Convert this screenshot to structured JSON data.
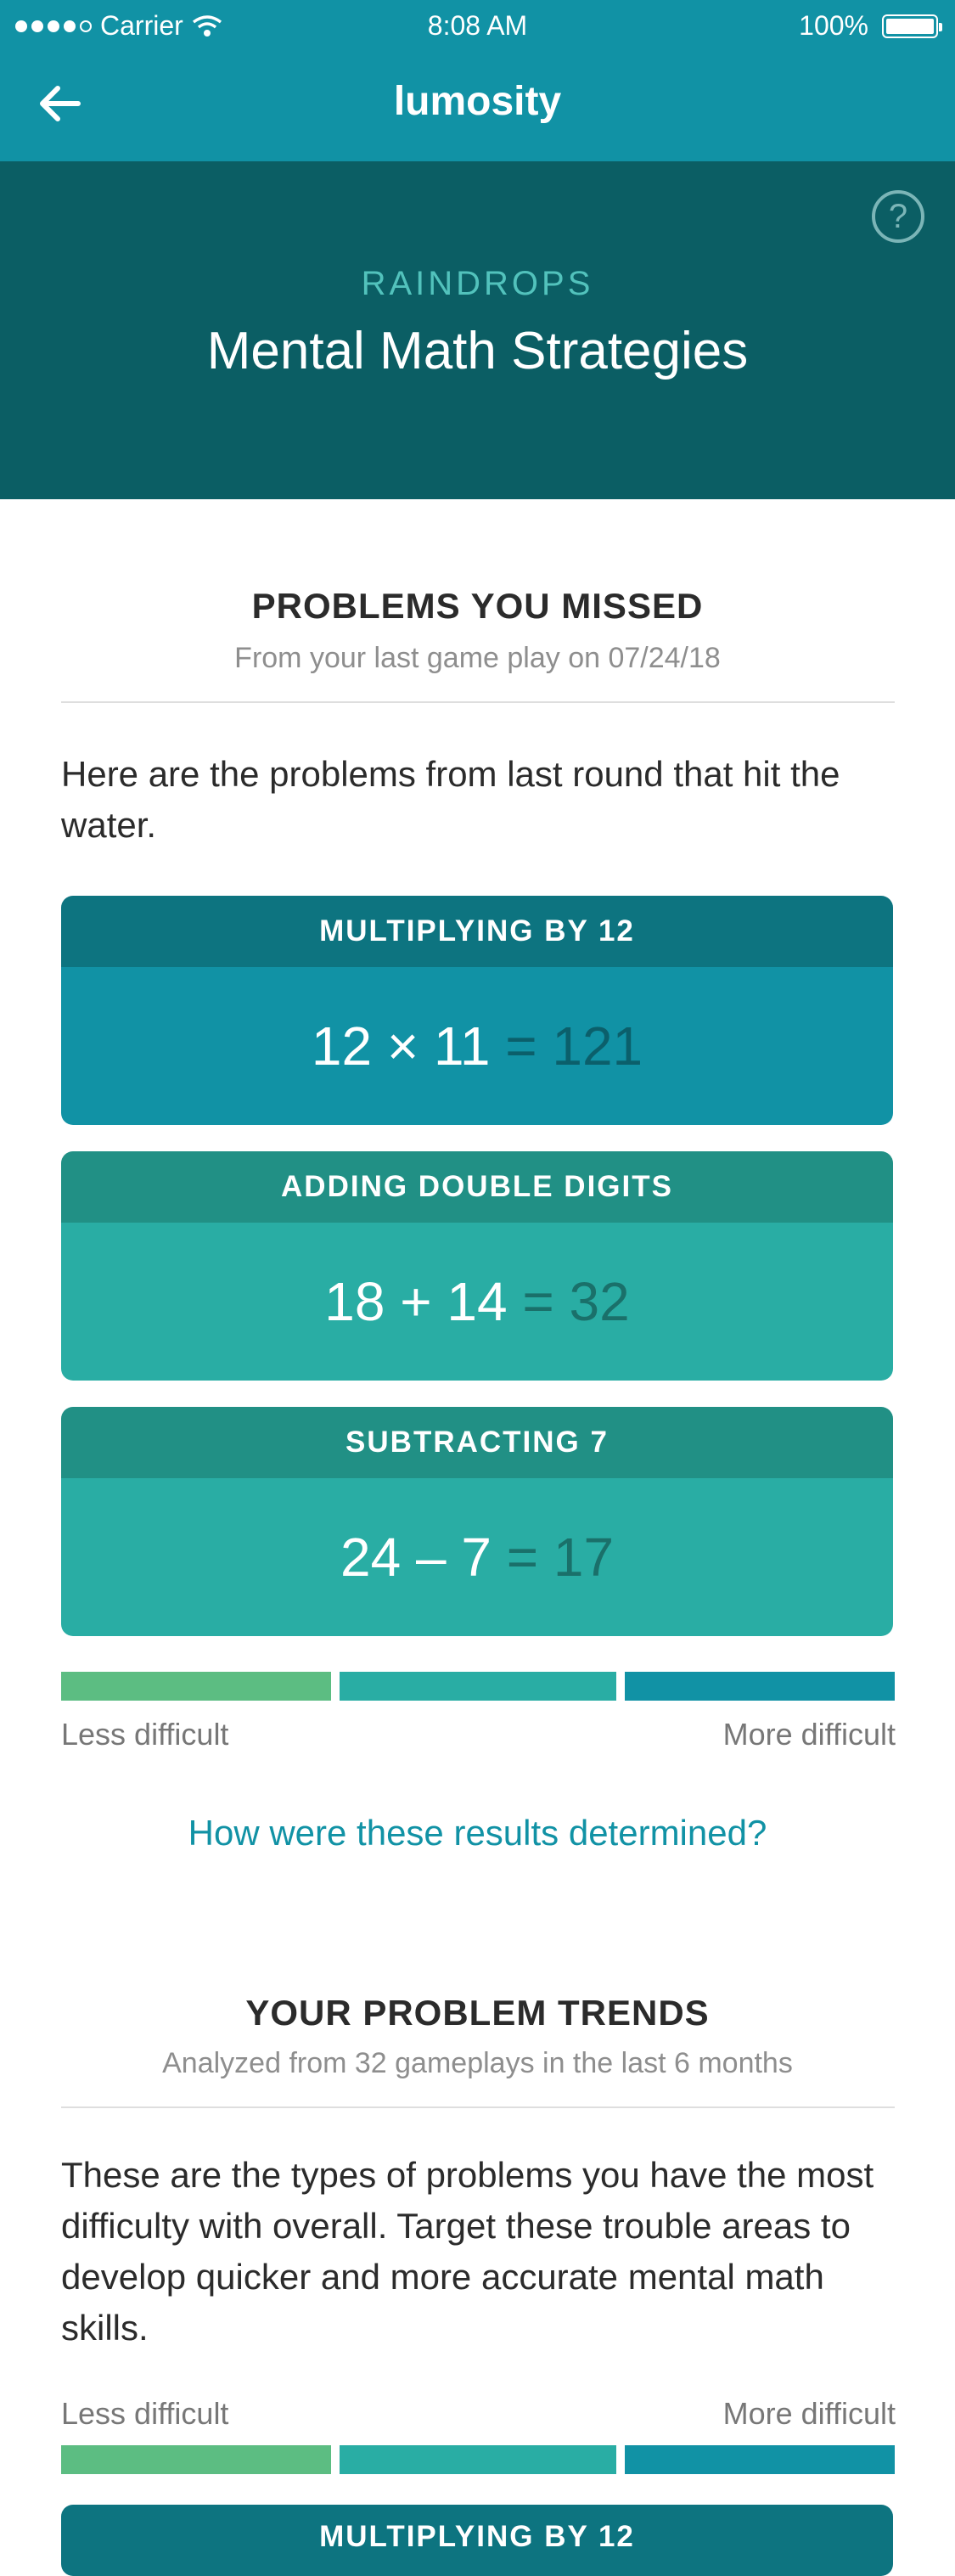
{
  "status": {
    "carrier": "Carrier",
    "time": "8:08 AM",
    "battery": "100%"
  },
  "nav": {
    "title": "lumosity"
  },
  "header": {
    "kicker": "RAINDROPS",
    "title": "Mental Math Strategies",
    "help_label": "?"
  },
  "missed": {
    "title": "PROBLEMS YOU MISSED",
    "subtitle": "From your last game play on 07/24/18",
    "description": "Here are the problems from last round that hit the water.",
    "cards": [
      {
        "category": "MULTIPLYING BY 12",
        "expression": "12 × 11",
        "equals": "=",
        "answer": "121"
      },
      {
        "category": "ADDING DOUBLE DIGITS",
        "expression": "18 + 14",
        "equals": "=",
        "answer": "32"
      },
      {
        "category": "SUBTRACTING 7",
        "expression": "24 – 7",
        "equals": "=",
        "answer": "17"
      }
    ],
    "legend": {
      "less": "Less difficult",
      "more": "More difficult"
    },
    "link": "How were these results determined?"
  },
  "trends": {
    "title": "YOUR PROBLEM TRENDS",
    "subtitle": "Analyzed from 32 gameplays in the last 6 months",
    "description": "These are the types of problems you have the most difficulty with overall. Target these trouble areas to develop quicker and more accurate mental math skills.",
    "legend": {
      "less": "Less difficult",
      "more": "More difficult"
    },
    "cards": [
      {
        "category": "MULTIPLYING BY 12"
      }
    ]
  },
  "colors": {
    "nav": "#1192a5",
    "header": "#0b5e64",
    "less_difficult": "#5cbd82",
    "medium_difficult": "#29ada4",
    "more_difficult": "#1192a5"
  }
}
